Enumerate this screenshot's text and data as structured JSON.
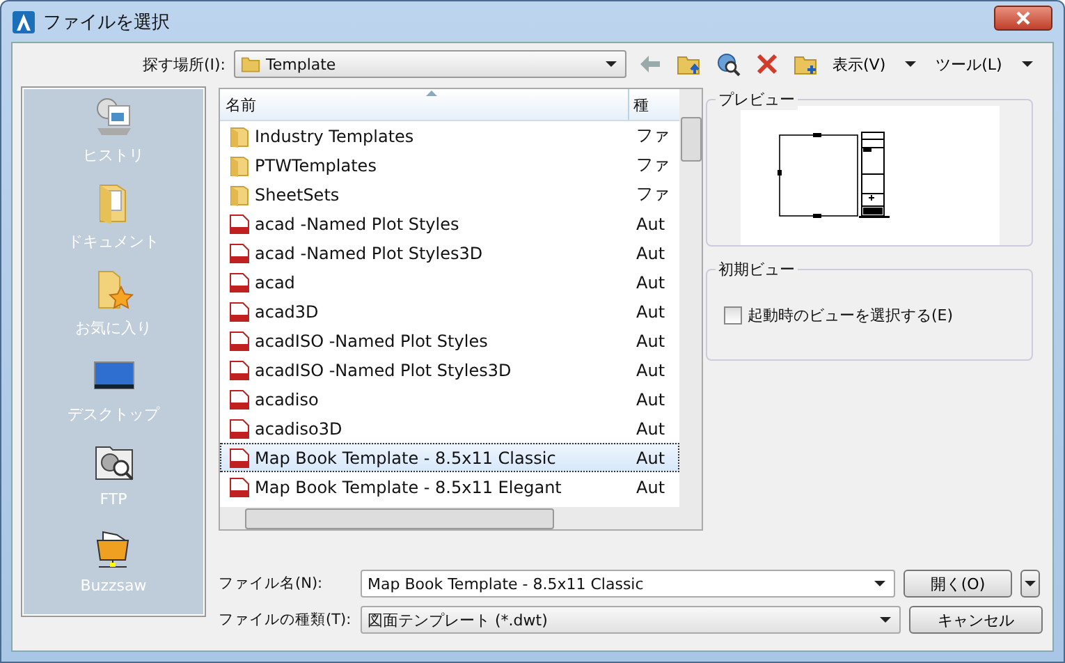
{
  "window": {
    "title": "ファイルを選択"
  },
  "toolbar": {
    "look_in_label": "探す場所(I):",
    "look_in_value": "Template",
    "view_menu": "表示(V)",
    "tools_menu": "ツール(L)"
  },
  "places": [
    {
      "label": "ヒストリ",
      "kind": "history"
    },
    {
      "label": "ドキュメント",
      "kind": "documents"
    },
    {
      "label": "お気に入り",
      "kind": "favorites"
    },
    {
      "label": "デスクトップ",
      "kind": "desktop"
    },
    {
      "label": "FTP",
      "kind": "ftp"
    },
    {
      "label": "Buzzsaw",
      "kind": "buzzsaw"
    }
  ],
  "file_list": {
    "columns": [
      "名前",
      "種"
    ],
    "rows": [
      {
        "name": "Industry Templates",
        "type": "ファ",
        "kind": "folder",
        "selected": false
      },
      {
        "name": "PTWTemplates",
        "type": "ファ",
        "kind": "folder",
        "selected": false
      },
      {
        "name": "SheetSets",
        "type": "ファ",
        "kind": "folder",
        "selected": false
      },
      {
        "name": "acad -Named Plot Styles",
        "type": "Aut",
        "kind": "dwt",
        "selected": false
      },
      {
        "name": "acad -Named Plot Styles3D",
        "type": "Aut",
        "kind": "dwt",
        "selected": false
      },
      {
        "name": "acad",
        "type": "Aut",
        "kind": "dwt",
        "selected": false
      },
      {
        "name": "acad3D",
        "type": "Aut",
        "kind": "dwt",
        "selected": false
      },
      {
        "name": "acadISO -Named Plot Styles",
        "type": "Aut",
        "kind": "dwt",
        "selected": false
      },
      {
        "name": "acadISO -Named Plot Styles3D",
        "type": "Aut",
        "kind": "dwt",
        "selected": false
      },
      {
        "name": "acadiso",
        "type": "Aut",
        "kind": "dwt",
        "selected": false
      },
      {
        "name": "acadiso3D",
        "type": "Aut",
        "kind": "dwt",
        "selected": false
      },
      {
        "name": "Map Book Template - 8.5x11 Classic",
        "type": "Aut",
        "kind": "dwt",
        "selected": true
      },
      {
        "name": "Map Book Template - 8.5x11 Elegant",
        "type": "Aut",
        "kind": "dwt",
        "selected": false
      }
    ]
  },
  "preview": {
    "title": "プレビュー"
  },
  "initial_view": {
    "title": "初期ビュー",
    "checkbox_label": "起動時のビューを選択する(E)",
    "checked": false
  },
  "file_name": {
    "label": "ファイル名(N):",
    "value": "Map Book Template - 8.5x11 Classic"
  },
  "file_type": {
    "label": "ファイルの種類(T):",
    "value": "図面テンプレート (*.dwt)"
  },
  "buttons": {
    "open": "開く(O)",
    "cancel": "キャンセル"
  }
}
